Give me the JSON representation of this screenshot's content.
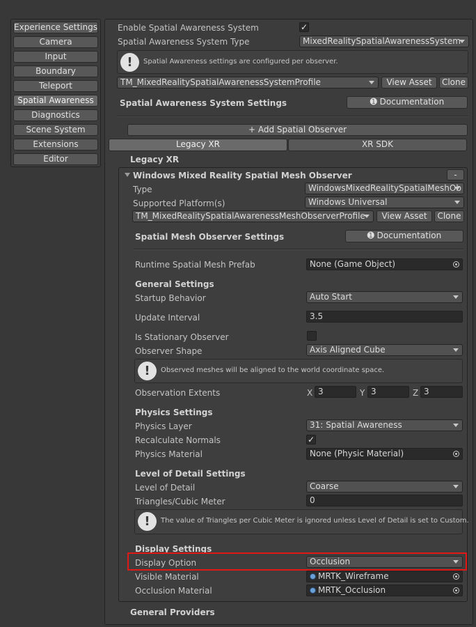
{
  "sidebar": {
    "items": [
      {
        "label": "Experience Settings",
        "selected": false
      },
      {
        "label": "Camera",
        "selected": false
      },
      {
        "label": "Input",
        "selected": false
      },
      {
        "label": "Boundary",
        "selected": false
      },
      {
        "label": "Teleport",
        "selected": false
      },
      {
        "label": "Spatial Awareness",
        "selected": true
      },
      {
        "label": "Diagnostics",
        "selected": false
      },
      {
        "label": "Scene System",
        "selected": false
      },
      {
        "label": "Extensions",
        "selected": false
      },
      {
        "label": "Editor",
        "selected": false
      }
    ]
  },
  "top": {
    "enable_label": "Enable Spatial Awareness System",
    "enable_checked": "✓",
    "system_type_label": "Spatial Awareness System Type",
    "system_type_value": "MixedRealitySpatialAwarenessSystem",
    "help_text": "Spatial Awareness settings are configured per observer.",
    "profile_value": "TM_MixedRealitySpatialAwarenessSystemProfile",
    "view_asset": "View Asset",
    "clone": "Clone",
    "section_title": "Spatial Awareness System Settings",
    "documentation": "Documentation",
    "add_observer": "+ Add Spatial Observer"
  },
  "tabs": [
    {
      "label": "Legacy XR",
      "active": true
    },
    {
      "label": "XR SDK",
      "active": false
    }
  ],
  "legacy_title": "Legacy XR",
  "observer": {
    "title": "Windows Mixed Reality Spatial Mesh Observer",
    "remove": "-",
    "type_label": "Type",
    "type_value": "WindowsMixedRealitySpatialMeshOb",
    "platform_label": "Supported Platform(s)",
    "platform_value": "Windows Universal",
    "profile_value": "TM_MixedRealitySpatialAwarenessMeshObserverProfile",
    "view_asset": "View Asset",
    "clone": "Clone",
    "settings_title": "Spatial Mesh Observer Settings",
    "documentation": "Documentation",
    "prefab_label": "Runtime Spatial Mesh Prefab",
    "prefab_value": "None (Game Object)",
    "general_title": "General Settings",
    "startup_label": "Startup Behavior",
    "startup_value": "Auto Start",
    "interval_label": "Update Interval",
    "interval_value": "3.5",
    "stationary_label": "Is Stationary Observer",
    "shape_label": "Observer Shape",
    "shape_value": "Axis Aligned Cube",
    "shape_help": "Observed meshes will be aligned to the world coordinate space.",
    "extents_label": "Observation Extents",
    "extents": [
      {
        "axis": "X",
        "value": "3"
      },
      {
        "axis": "Y",
        "value": "3"
      },
      {
        "axis": "Z",
        "value": "3"
      }
    ],
    "physics_title": "Physics Settings",
    "physics_layer_label": "Physics Layer",
    "physics_layer_value": "31: Spatial Awareness",
    "recalc_label": "Recalculate Normals",
    "recalc_checked": "✓",
    "physics_material_label": "Physics Material",
    "physics_material_value": "None (Physic Material)",
    "lod_title": "Level of Detail Settings",
    "lod_label": "Level of Detail",
    "lod_value": "Coarse",
    "triangles_label": "Triangles/Cubic Meter",
    "triangles_value": "0",
    "lod_help": "The value of Triangles per Cubic Meter is ignored unless Level of Detail is set to Custom.",
    "display_title": "Display Settings",
    "display_option_label": "Display Option",
    "display_option_value": "Occlusion",
    "visible_material_label": "Visible Material",
    "visible_material_value": "MRTK_Wireframe",
    "occlusion_material_label": "Occlusion Material",
    "occlusion_material_value": "MRTK_Occlusion"
  },
  "general_providers": "General Providers",
  "colors": {
    "highlight": "#e01818",
    "material_icon": "#6aa0d8"
  }
}
